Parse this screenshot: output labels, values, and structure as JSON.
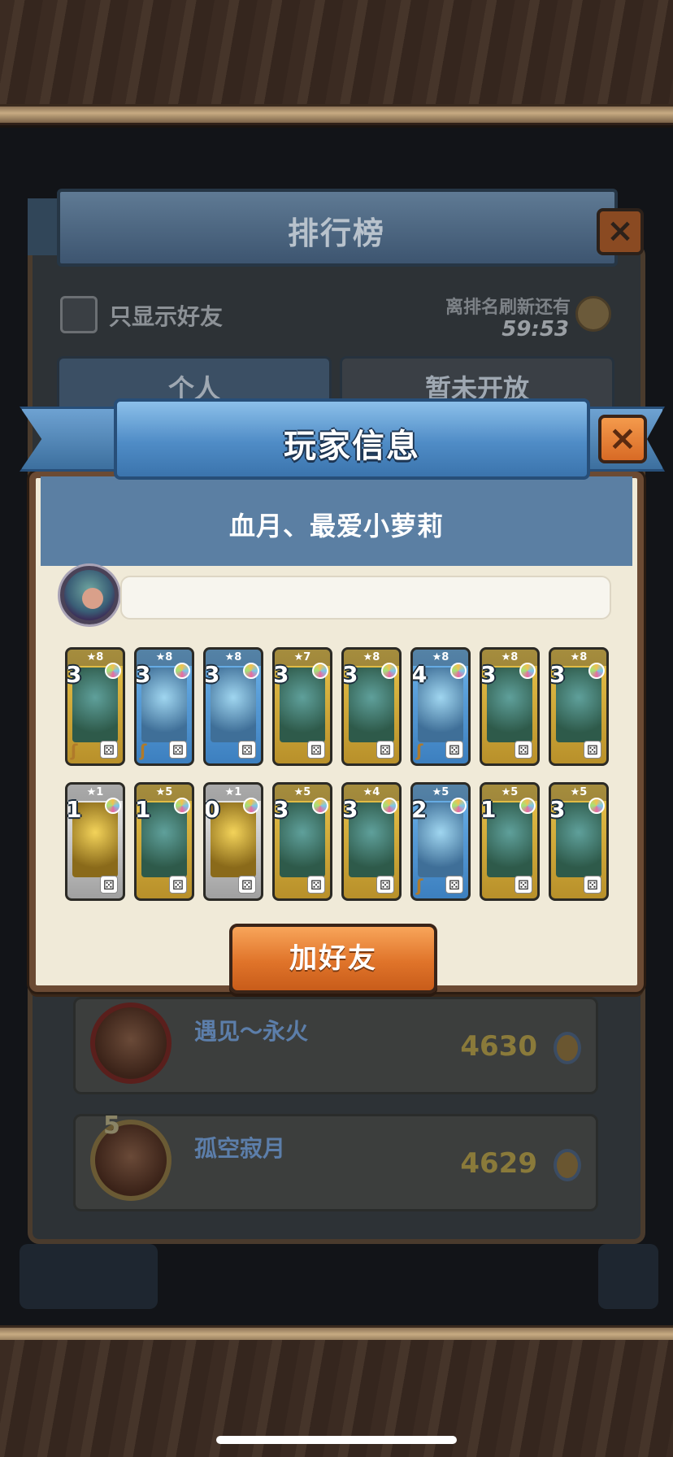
{
  "ranking": {
    "title": "排行榜",
    "close_icon": "×",
    "friends_only_label": "只显示好友",
    "refresh_label": "离排名刷新还有",
    "refresh_timer": "59:53",
    "tabs": [
      {
        "label": "个人"
      },
      {
        "label": "暂未开放"
      }
    ],
    "rows": [
      {
        "rank": "",
        "name": "遇见～永火",
        "score": "4630"
      },
      {
        "rank": "5",
        "name": "孤空寂月",
        "score": "4629"
      }
    ]
  },
  "player_info": {
    "title": "玩家信息",
    "close_icon": "×",
    "player_name": "血月、最爱小萝莉",
    "message": "",
    "add_friend_label": "加好友",
    "card_rows": [
      [
        {
          "stars": "★8",
          "cost": "3",
          "color": "gold",
          "staff": true
        },
        {
          "stars": "★8",
          "cost": "3",
          "color": "blue",
          "staff": true
        },
        {
          "stars": "★8",
          "cost": "3",
          "color": "blue",
          "staff": false
        },
        {
          "stars": "★7",
          "cost": "3",
          "color": "gold",
          "staff": false
        },
        {
          "stars": "★8",
          "cost": "3",
          "color": "gold",
          "staff": false
        },
        {
          "stars": "★8",
          "cost": "4",
          "color": "blue",
          "staff": true
        },
        {
          "stars": "★8",
          "cost": "3",
          "color": "gold",
          "staff": false
        },
        {
          "stars": "★8",
          "cost": "3",
          "color": "gold",
          "staff": false
        }
      ],
      [
        {
          "stars": "★1",
          "cost": "1",
          "color": "gray",
          "staff": false
        },
        {
          "stars": "★5",
          "cost": "1",
          "color": "gold",
          "staff": false
        },
        {
          "stars": "★1",
          "cost": "0",
          "color": "gray",
          "staff": false
        },
        {
          "stars": "★5",
          "cost": "3",
          "color": "gold",
          "staff": false
        },
        {
          "stars": "★4",
          "cost": "3",
          "color": "gold",
          "staff": false
        },
        {
          "stars": "★5",
          "cost": "2",
          "color": "blue",
          "staff": true
        },
        {
          "stars": "★5",
          "cost": "1",
          "color": "gold",
          "staff": false
        },
        {
          "stars": "★5",
          "cost": "3",
          "color": "gold",
          "staff": false
        }
      ]
    ]
  },
  "icons": {
    "dice": "⚄",
    "staff": "ʃ"
  }
}
